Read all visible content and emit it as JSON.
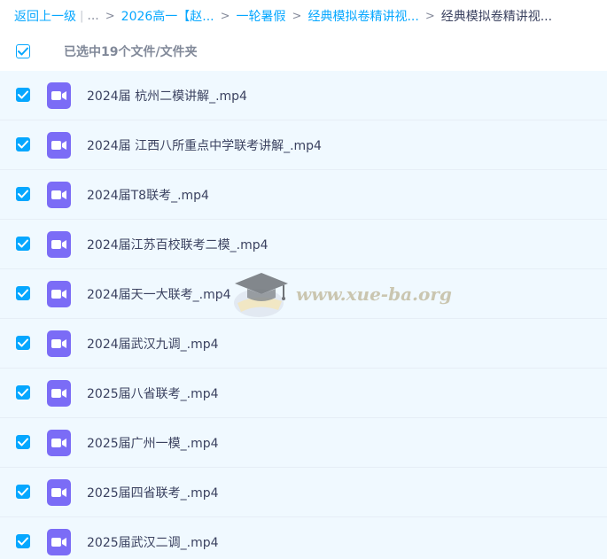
{
  "breadcrumb": {
    "back_label": "返回上一级",
    "pipe": "|",
    "ellipsis": "...",
    "separator": ">",
    "items": [
      "2026高一【赵...",
      "一轮暑假",
      "经典模拟卷精讲视..."
    ],
    "current": "经典模拟卷精讲视..."
  },
  "header": {
    "selection_label": "已选中19个文件/文件夹",
    "select_all_checked": true
  },
  "files": [
    {
      "name": "2024届 杭州二模讲解_.mp4",
      "checked": true,
      "icon": "video-file-icon"
    },
    {
      "name": "2024届 江西八所重点中学联考讲解_.mp4",
      "checked": true,
      "icon": "video-file-icon"
    },
    {
      "name": "2024届T8联考_.mp4",
      "checked": true,
      "icon": "video-file-icon"
    },
    {
      "name": "2024届江苏百校联考二模_.mp4",
      "checked": true,
      "icon": "video-file-icon"
    },
    {
      "name": "2024届天一大联考_.mp4",
      "checked": true,
      "icon": "video-file-icon"
    },
    {
      "name": "2024届武汉九调_.mp4",
      "checked": true,
      "icon": "video-file-icon"
    },
    {
      "name": "2025届八省联考_.mp4",
      "checked": true,
      "icon": "video-file-icon"
    },
    {
      "name": "2025届广州一模_.mp4",
      "checked": true,
      "icon": "video-file-icon"
    },
    {
      "name": "2025届四省联考_.mp4",
      "checked": true,
      "icon": "video-file-icon"
    },
    {
      "name": "2025届武汉二调_.mp4",
      "checked": true,
      "icon": "video-file-icon"
    }
  ],
  "watermark": {
    "text": "www.xue-ba.org"
  },
  "colors": {
    "accent": "#06a7ff",
    "row_selected_bg": "#f0f9ff",
    "video_icon": "#7b6cf6",
    "text_primary": "#3b4260",
    "text_muted": "#818999"
  }
}
